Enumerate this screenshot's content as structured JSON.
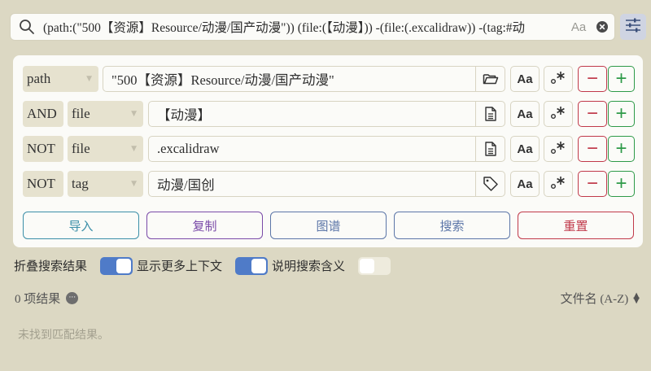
{
  "search": {
    "query": "(path:(\"500【资源】Resource/动漫/国产动漫\")) (file:(【动漫】)) -(file:(.excalidraw)) -(tag:#动",
    "match_case_label": "Aa"
  },
  "builder": {
    "rows": [
      {
        "operator": "path",
        "field": "",
        "value": "\"500【资源】Resource/动漫/国产动漫\"",
        "value_icon": "folder-icon"
      },
      {
        "operator": "AND",
        "field": "file",
        "value": "【动漫】",
        "value_icon": "file-text-icon"
      },
      {
        "operator": "NOT",
        "field": "file",
        "value": ".excalidraw",
        "value_icon": "file-text-icon"
      },
      {
        "operator": "NOT",
        "field": "tag",
        "value": "动漫/国创",
        "value_icon": "tag-icon"
      }
    ],
    "case_label": "Aa",
    "regex_label": "·*",
    "minus_label": "−",
    "plus_label": "+"
  },
  "actions": {
    "import": "导入",
    "copy": "复制",
    "graph": "图谱",
    "search": "搜索",
    "reset": "重置"
  },
  "options": {
    "collapse": "折叠搜索结果",
    "more_context": "显示更多上下文",
    "explain": "说明搜索含义"
  },
  "toggles": {
    "collapse": true,
    "more_context": true,
    "explain": false
  },
  "results": {
    "count_label": "0 项结果",
    "sort_label": "文件名 (A-Z)",
    "empty_message": "未找到匹配结果。"
  },
  "colors": {
    "background": "#dcd8c3",
    "accent": "#4f7bc8",
    "danger": "#c0394a",
    "success": "#2e9a48"
  }
}
